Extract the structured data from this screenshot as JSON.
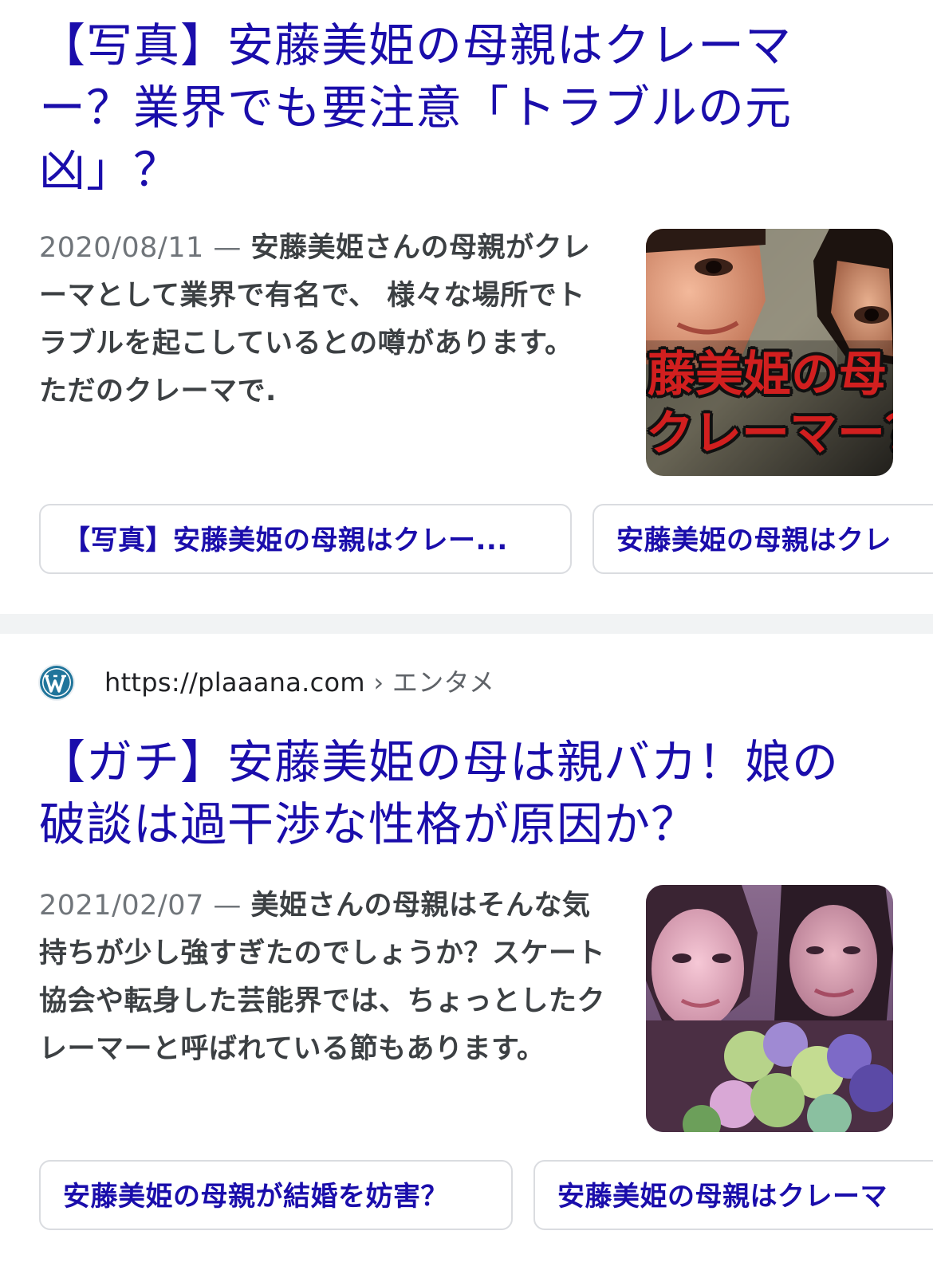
{
  "results": [
    {
      "title": "【写真】安藤美姫の母親はクレーマー？業界でも要注意「トラブルの元凶」？",
      "date": "2020/08/11",
      "separator": " — ",
      "snippet": "安藤美姫さんの母親がクレーマとして業界で有名で、 様々な場所でトラブルを起こしているとの噂があります。 ただのクレーマで.",
      "thumbnail_caption_line1": "藤美姫の母",
      "thumbnail_caption_line2": "クレーマー？",
      "chips": [
        "【写真】安藤美姫の母親はクレー...",
        "安藤美姫の母親はクレ"
      ]
    },
    {
      "site_url": "https://plaaana.com",
      "breadcrumb_separator": " › ",
      "breadcrumb": "エンタメ",
      "favicon": "wordpress-icon",
      "title": "【ガチ】安藤美姫の母は親バカ！娘の破談は過干渉な性格が原因か？",
      "date": "2021/02/07",
      "separator": " — ",
      "snippet": "美姫さんの母親はそんな気持ちが少し強すぎたのでしょうか？スケート協会や転身した芸能界では、ちょっとしたクレーマーと呼ばれている節もあります。",
      "chips": [
        "安藤美姫の母親が結婚を妨害？",
        "安藤美姫の母親はクレーマ"
      ]
    }
  ],
  "colors": {
    "title_link": "#1a0dab",
    "snippet_text": "#3c4043",
    "date_text": "#70757a",
    "separator_band": "#f1f3f4",
    "chip_border": "#dadce0"
  }
}
